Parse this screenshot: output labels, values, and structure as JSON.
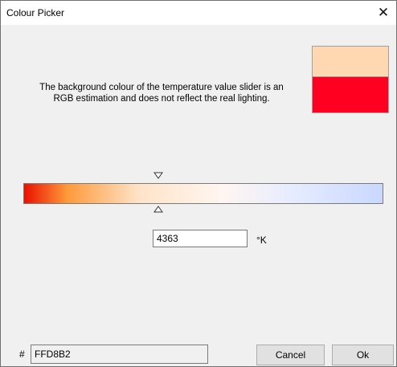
{
  "window": {
    "title": "Colour Picker",
    "close_glyph": "✕",
    "close_icon": "close-icon"
  },
  "preview": {
    "selected_color": "#FFD8B2",
    "original_color": "#FF0020"
  },
  "note": "The background colour of the temperature value slider is an RGB estimation and does not reflect the real lighting.",
  "slider": {
    "gradient_colors": [
      "#e81000",
      "#ff9a3a",
      "#ffe3c8",
      "#fff6f0",
      "#e6ecff",
      "#c9d8ff"
    ],
    "position_fraction": 0.375,
    "thumb_icons": [
      "triangle-down-icon",
      "triangle-up-icon"
    ]
  },
  "temperature": {
    "value": "4363",
    "unit": "°K"
  },
  "hex": {
    "prefix": "#",
    "value": "FFD8B2"
  },
  "buttons": {
    "cancel": "Cancel",
    "ok": "Ok"
  }
}
